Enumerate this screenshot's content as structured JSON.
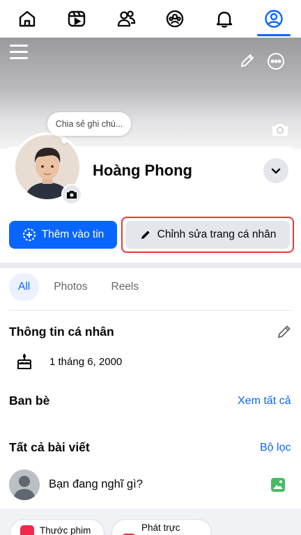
{
  "nav": {
    "items": [
      {
        "name": "home",
        "icon": "home-icon"
      },
      {
        "name": "reels",
        "icon": "video-icon"
      },
      {
        "name": "friends",
        "icon": "friends-icon"
      },
      {
        "name": "groups",
        "icon": "groups-icon"
      },
      {
        "name": "notifications",
        "icon": "bell-icon"
      },
      {
        "name": "profile",
        "icon": "profile-icon",
        "active": true
      }
    ],
    "active_color": "#0866ff"
  },
  "profile": {
    "note_placeholder": "Chia sẻ ghi chú...",
    "name": "Hoàng Phong",
    "add_story_label": "Thêm vào tin",
    "edit_profile_label": "Chỉnh sửa trang cá nhân"
  },
  "tabs": [
    {
      "label": "All",
      "active": true
    },
    {
      "label": "Photos"
    },
    {
      "label": "Reels"
    }
  ],
  "about": {
    "title": "Thông tin cá nhân",
    "birthday": "1 tháng 6, 2000"
  },
  "friends": {
    "title": "Ban bè",
    "see_all": "Xem tất cả"
  },
  "posts": {
    "title": "Tất cả bài viết",
    "filter": "Bộ lọc",
    "composer_placeholder": "Bạn đang nghĩ gì?"
  },
  "chips": {
    "reel": "Thước phim",
    "live": "Phát trực"
  },
  "colors": {
    "primary": "#0866ff",
    "highlight_border": "#e23a3a",
    "secondary_button": "#e4e6eb"
  }
}
